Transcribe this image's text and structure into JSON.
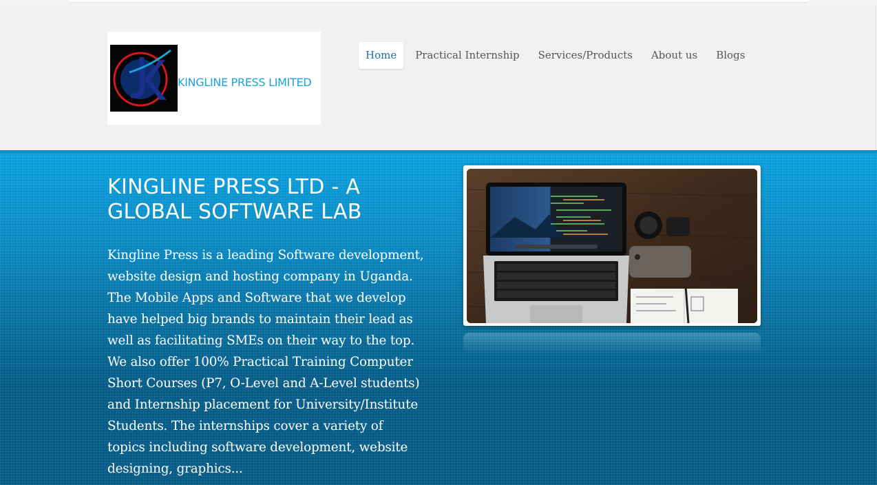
{
  "brand": {
    "logo_text": "KINGLINE PRESS LIMITED",
    "logo_icon": "kingline-jk-emblem-icon"
  },
  "nav": {
    "items": [
      {
        "label": "Home",
        "active": true
      },
      {
        "label": "Practical Internship",
        "active": false
      },
      {
        "label": "Services/Products",
        "active": false
      },
      {
        "label": "About us",
        "active": false
      },
      {
        "label": "Blogs",
        "active": false
      }
    ]
  },
  "hero": {
    "title": "KINGLINE PRESS LTD - A GLOBAL SOFTWARE LAB",
    "body": "Kingline Press is a leading Software development, website design and hosting company in Uganda. The Mobile Apps and Software that we develop have helped big brands to maintain their lead as well as facilitating SMEs on their way to the top. We also offer 100% Practical Training Computer Short Courses (P7, O-Level and A-Level students) and Internship placement for University/Institute Students. The internships cover a variety of topics including software development, website designing, graphics...",
    "image_label": "laptop-workspace-photo"
  },
  "colors": {
    "header_bg": "#f0f2f1",
    "hero_top": "#0aa0de",
    "hero_bottom": "#065c86",
    "nav_active_text": "#1d6f9c",
    "logo_text": "#1aa3dd",
    "logo_ring": "#d8161d"
  }
}
